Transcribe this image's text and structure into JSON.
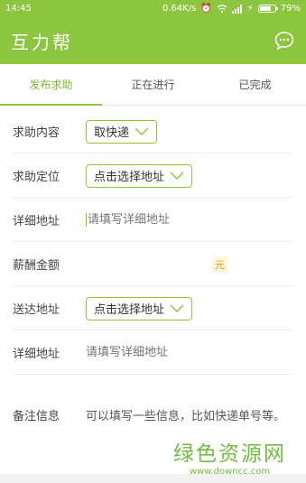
{
  "status_bar": {
    "time": "14:45",
    "speed": "0.64K/s",
    "battery": "79%",
    "battery_level": 0.79
  },
  "app_bar": {
    "title": "互力帮",
    "chat_icon": "chat-bubble-icon"
  },
  "tabs": [
    {
      "label": "发布求助",
      "active": true
    },
    {
      "label": "正在进行",
      "active": false
    },
    {
      "label": "已完成",
      "active": false
    }
  ],
  "form": {
    "content_label": "求助内容",
    "content_value": "取快递",
    "location_label": "求助定位",
    "location_value": "点击选择地址",
    "detail_label": "详细地址",
    "detail_placeholder": "请填写详细地址",
    "reward_label": "薪酬金额",
    "reward_unit": "元",
    "delivery_label": "送达地址",
    "delivery_value": "点击选择地址",
    "detail2_label": "详细地址",
    "detail2_placeholder": "请填写详细地址",
    "remark_label": "备注信息",
    "remark_placeholder": "可以填写一些信息，比如快递单号等。"
  },
  "watermark": {
    "big": "绿色资源网",
    "small": "www.downcc.com"
  },
  "colors": {
    "primary": "#8cc63f",
    "tab_active": "#7cb82f"
  }
}
